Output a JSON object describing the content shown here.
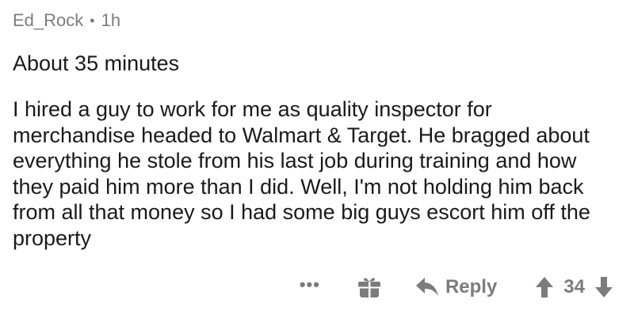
{
  "comment": {
    "author": "Ed_Rock",
    "separator": "•",
    "age": "1h",
    "title": "About 35 minutes",
    "body": "I hired a guy to work for me as quality inspector for merchandise headed to Walmart & Target. He bragged about everything he stole from his last job during training and how they paid him more than I did. Well, I'm not holding him back from all that money so I had some big guys escort him off the property"
  },
  "actions": {
    "more": "•••",
    "reply_label": "Reply",
    "score": "34"
  },
  "icons": {
    "more": "more-options-icon",
    "gift": "gift-icon",
    "reply": "reply-arrow-icon",
    "upvote": "upvote-arrow-icon",
    "downvote": "downvote-arrow-icon"
  },
  "colors": {
    "text": "#1a1a1b",
    "meta": "#7c7c7c"
  }
}
